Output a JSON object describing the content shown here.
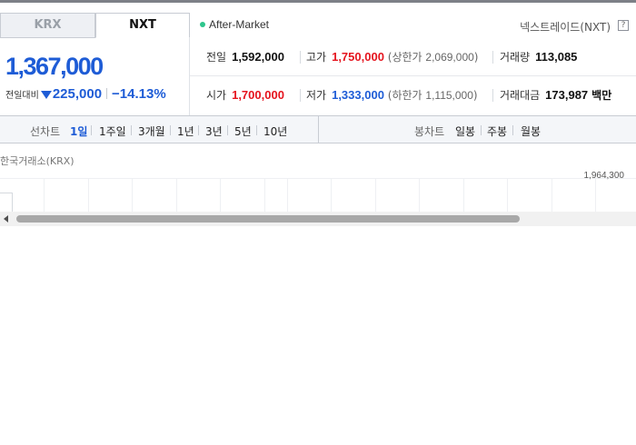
{
  "market_tabs": [
    {
      "label": "KRX",
      "active": false
    },
    {
      "label": "NXT",
      "active": true
    }
  ],
  "session": {
    "label": "After-Market",
    "color": "#2ec58c"
  },
  "exchange": {
    "name": "넥스트레이드(NXT)",
    "help_icon": "question-icon",
    "help_label": "?"
  },
  "quote": {
    "price": "1,367,000",
    "change_label": "전일대비",
    "change_direction": "down",
    "change_value": "225,000",
    "change_rate": "−14.13%",
    "color": "#1e5cd6"
  },
  "stats": {
    "prev_close": {
      "label": "전일",
      "value": "1,592,000"
    },
    "high": {
      "label": "고가",
      "value": "1,750,000",
      "sub_prefix": "(상한가",
      "sub_value": "2,069,000",
      "sub_suffix": ")"
    },
    "volume": {
      "label": "거래량",
      "value": "113,085"
    },
    "open": {
      "label": "시가",
      "value": "1,700,000"
    },
    "low": {
      "label": "저가",
      "value": "1,333,000",
      "sub_prefix": "(하한가",
      "sub_value": "1,115,000",
      "sub_suffix": ")"
    },
    "amount": {
      "label": "거래대금",
      "value": "173,987",
      "unit": "백만"
    }
  },
  "period_bar": {
    "line_label": "선차트",
    "line_periods": [
      "1일",
      "1주일",
      "3개월",
      "1년",
      "3년",
      "5년",
      "10년"
    ],
    "active_period": "1일",
    "candle_label": "봉차트",
    "candle_periods": [
      "일봉",
      "주봉",
      "월봉"
    ]
  },
  "chart": {
    "source": "한국거래소(KRX)",
    "y_tick": "1,964,300"
  },
  "colors": {
    "up": "#e5141e",
    "down": "#1e5cd6",
    "accent": "#1e5cd6"
  }
}
